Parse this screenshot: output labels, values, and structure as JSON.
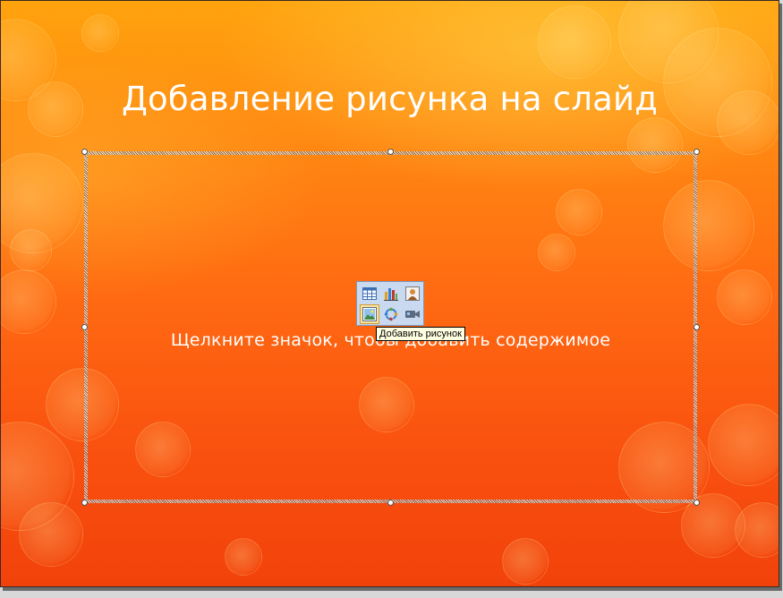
{
  "slide": {
    "title": "Добавление рисунка на слайд",
    "placeholder_text": "Щелкните значок, чтобы добавить содержимое"
  },
  "content_icons": [
    {
      "name": "insert-table-icon"
    },
    {
      "name": "insert-chart-icon"
    },
    {
      "name": "insert-clip-art-icon"
    },
    {
      "name": "insert-picture-icon",
      "hovered": true
    },
    {
      "name": "insert-smartart-icon"
    },
    {
      "name": "insert-media-icon"
    }
  ],
  "tooltip": {
    "text": "Добавить рисунок"
  },
  "colors": {
    "background_top": "#ffa30d",
    "background_bottom": "#f2420b",
    "text": "#ffffff",
    "palette_bg": "#c9d9ef",
    "tooltip_bg": "#ffffe1"
  }
}
